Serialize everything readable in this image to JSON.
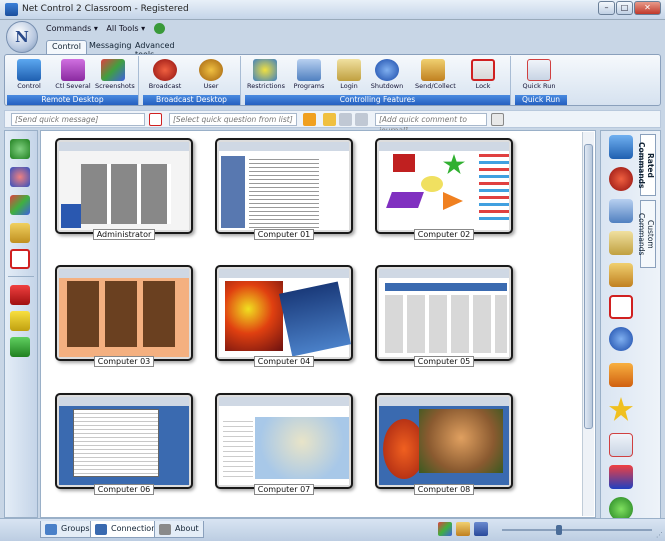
{
  "window": {
    "title": "Net Control 2 Classroom - Registered",
    "min": "–",
    "max": "□",
    "close": "✕"
  },
  "app_orb": "N",
  "quick_access": {
    "commands": "Commands ▾",
    "all_tools": "All Tools ▾"
  },
  "tabs": [
    {
      "label": "Control"
    },
    {
      "label": "Messaging"
    },
    {
      "label": "Advanced tools"
    }
  ],
  "ribbon": {
    "groups": [
      {
        "label": "Remote Desktop",
        "buttons": [
          "Control",
          "Ctl Several",
          "Screenshots"
        ]
      },
      {
        "label": "Broadcast Desktop",
        "buttons": [
          "Broadcast",
          "User"
        ]
      },
      {
        "label": "Controlling Features",
        "buttons": [
          "Restrictions",
          "Programs",
          "Login",
          "Shutdown",
          "Send/Collect",
          "Lock"
        ]
      },
      {
        "label": "Quick Run",
        "buttons": [
          "Quick Run"
        ]
      }
    ]
  },
  "quickbar": {
    "message_placeholder": "[Send quick message]",
    "question_placeholder": "[Select quick question from list]",
    "journal_placeholder": "[Add quick comment to journal]"
  },
  "computers": [
    {
      "label": "Administrator",
      "theme": "admin"
    },
    {
      "label": "Computer 01",
      "theme": "doc"
    },
    {
      "label": "Computer 02",
      "theme": "shapes"
    },
    {
      "label": "Computer 03",
      "theme": "photos"
    },
    {
      "label": "Computer 04",
      "theme": "art"
    },
    {
      "label": "Computer 05",
      "theme": "web"
    },
    {
      "label": "Computer 06",
      "theme": "files"
    },
    {
      "label": "Computer 07",
      "theme": "map"
    },
    {
      "label": "Computer 08",
      "theme": "cat"
    }
  ],
  "right_tabs": {
    "rated": "Rated Commands",
    "custom": "Custom Commands"
  },
  "status_tabs": {
    "groups": "Groups",
    "connections": "Connections",
    "about": "About"
  },
  "colors": {
    "accent": "#2460c0",
    "ribbon_bg": "#d6e2f0",
    "frame": "#c8d6e6"
  },
  "icons": {
    "left": [
      "recycle-icon",
      "no-entry-icon",
      "color-grid-icon",
      "lock-icon",
      "text-tag-icon",
      "red-flag-icon",
      "yellow-flag-icon",
      "green-flag-icon"
    ],
    "right": [
      "monitor-icon",
      "broadcast-icon",
      "programs-icon",
      "key-icon",
      "scroll-icon",
      "cross-icon",
      "power-icon",
      "question-icon",
      "star-icon",
      "quickrun-icon",
      "az-icon",
      "hello-icon"
    ]
  }
}
